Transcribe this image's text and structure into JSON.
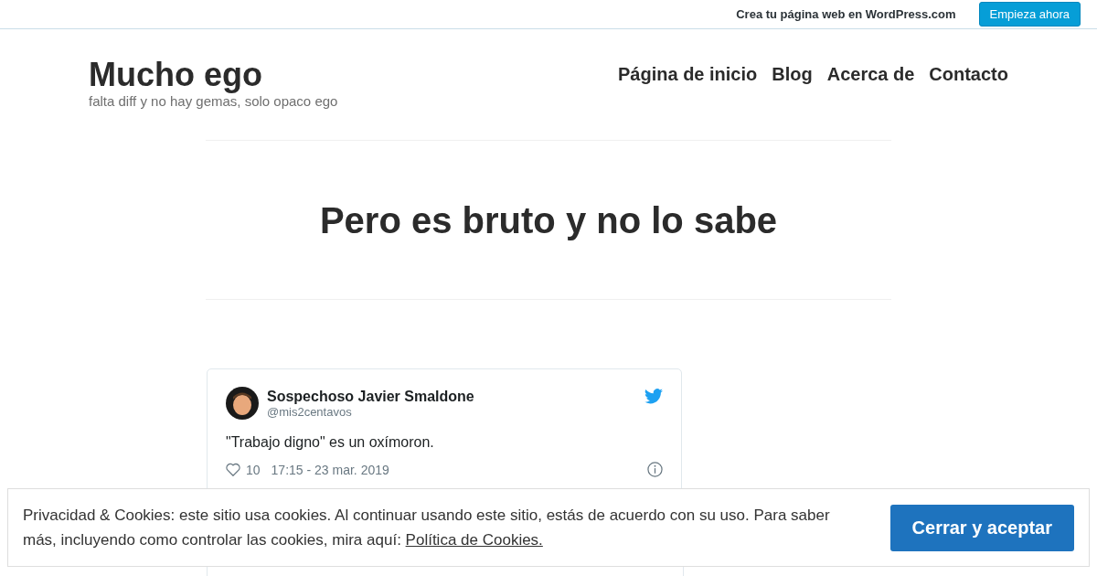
{
  "top_bar": {
    "promo": "Crea tu página web en WordPress.com",
    "button": "Empieza ahora"
  },
  "site": {
    "title": "Mucho ego",
    "tagline": "falta diff y no hay gemas, solo opaco ego"
  },
  "nav": [
    {
      "label": "Página de inicio"
    },
    {
      "label": "Blog"
    },
    {
      "label": "Acerca de"
    },
    {
      "label": "Contacto"
    }
  ],
  "page_title": "Pero es bruto y no lo sabe",
  "tweet": {
    "name": "Sospechoso Javier Smaldone",
    "handle": "@mis2centavos",
    "text": "\"Trabajo digno\" es un oxímoron.",
    "likes": "10",
    "time": "17:15 - 23 mar. 2019"
  },
  "cookie_banner": {
    "text": "Privacidad & Cookies: este sitio usa cookies. Al continuar usando este sitio, estás de acuerdo con su uso. Para saber más, incluyendo como controlar las cookies, mira aquí:",
    "link": "Política de Cookies.",
    "button": "Cerrar y aceptar"
  }
}
